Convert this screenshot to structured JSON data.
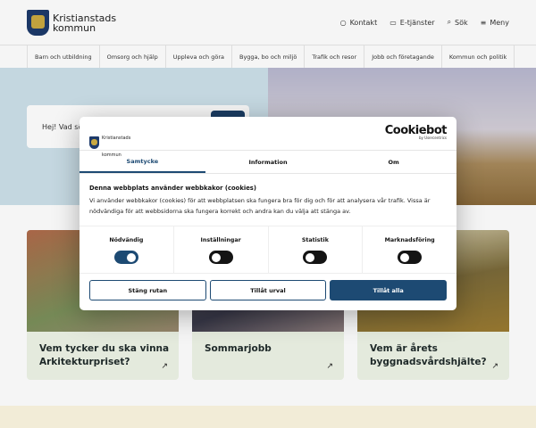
{
  "header": {
    "logo_line1": "Kristianstads",
    "logo_line2": "kommun",
    "links": [
      {
        "label": "Kontakt",
        "icon": "chat-icon"
      },
      {
        "label": "E-tjänster",
        "icon": "monitor-icon"
      },
      {
        "label": "Sök",
        "icon": "search-icon"
      },
      {
        "label": "Meny",
        "icon": "menu-icon"
      }
    ]
  },
  "nav": [
    "Barn och utbildning",
    "Omsorg och hjälp",
    "Uppleva och göra",
    "Bygga, bo och miljö",
    "Trafik och resor",
    "Jobb och företagande",
    "Kommun och politik"
  ],
  "hero": {
    "search_placeholder": "Hej! Vad sö"
  },
  "cards": [
    {
      "title": "Vem tycker du ska vinna Arkitekturpriset?"
    },
    {
      "title": "Sommarjobb"
    },
    {
      "title": "Vem är årets byggnadsvårdshjälte?"
    }
  ],
  "cookie": {
    "logo_line1": "Kristianstads",
    "logo_line2": "kommun",
    "brand": "Cookiebot",
    "brand_sub": "by Usercentrics",
    "tabs": [
      "Samtycke",
      "Information",
      "Om"
    ],
    "heading": "Denna webbplats använder webbkakor (cookies)",
    "text": "Vi använder webbkakor (cookies) för att webbplatsen ska fungera bra för dig och för att analysera vår trafik. Vissa är nödvändiga för att webbsidorna ska fungera korrekt och andra kan du välja att stänga av.",
    "toggles": [
      {
        "label": "Nödvändig",
        "on": true
      },
      {
        "label": "Inställningar",
        "on": false
      },
      {
        "label": "Statistik",
        "on": false
      },
      {
        "label": "Marknadsföring",
        "on": false
      }
    ],
    "buttons": {
      "close": "Stäng rutan",
      "selection": "Tillåt urval",
      "all": "Tillåt alla"
    },
    "accent": "#1d4a73"
  }
}
